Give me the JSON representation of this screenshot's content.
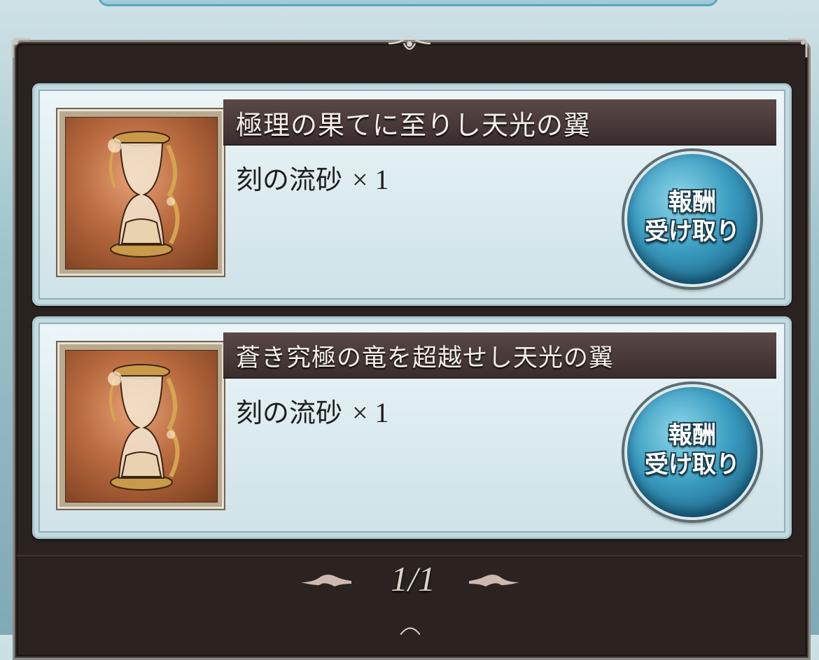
{
  "rewards": [
    {
      "title": "極理の果てに至りし天光の翼",
      "item_name": "刻の流砂",
      "quantity": "× 1",
      "item_icon": "hourglass-icon",
      "claim_label_line1": "報酬",
      "claim_label_line2": "受け取り"
    },
    {
      "title": "蒼き究極の竜を超越せし天光の翼",
      "item_name": "刻の流砂",
      "quantity": "× 1",
      "item_icon": "hourglass-icon",
      "claim_label_line1": "報酬",
      "claim_label_line2": "受け取り"
    }
  ],
  "pagination": {
    "label": "1/1",
    "prev_icon": "arrow-left-icon",
    "next_icon": "arrow-right-icon"
  },
  "colors": {
    "panel_background": "#2b2320",
    "card_background": "#dcebef",
    "title_bar": "#4a3a3a",
    "claim_button": "#3a9cc0"
  }
}
